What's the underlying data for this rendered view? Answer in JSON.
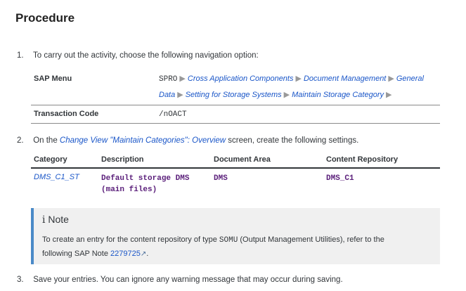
{
  "heading": "Procedure",
  "steps": {
    "s1": {
      "num": "1.",
      "text": "To carry out the activity, choose the following navigation option:"
    },
    "s2": {
      "num": "2.",
      "prefix": "On the ",
      "link": "Change View \"Maintain Categories\": Overview",
      "suffix": " screen, create the following settings."
    },
    "s3": {
      "num": "3.",
      "text": "Save your entries. You can ignore any warning message that may occur during saving."
    }
  },
  "nav_table": {
    "row1_label": "SAP Menu",
    "spro": "SPRO",
    "path": [
      "Cross Application Components",
      "Document Management",
      "General",
      "Data",
      "Setting for Storage Systems",
      "Maintain Storage Category"
    ],
    "row2_label": "Transaction Code",
    "transaction": "/nOACT"
  },
  "settings_table": {
    "headers": [
      "Category",
      "Description",
      "Document Area",
      "Content Repository"
    ],
    "row": {
      "category": "DMS_C1_ST",
      "description_line1": "Default storage DMS",
      "description_line2": "(main files)",
      "area": "DMS",
      "repository": "DMS_C1"
    }
  },
  "note": {
    "icon": "i",
    "title": "Note",
    "text_prefix": "To create an entry for the content repository of type ",
    "code": "SOMU",
    "text_middle": " (Output Management Utilities), refer to the",
    "text_line2": "following SAP Note ",
    "note_number": "2279725",
    "ext_icon": "↗",
    "text_end": "."
  },
  "colors": {
    "link": "#1a56c8",
    "note_bar": "#4a8ac8",
    "code": "#5a1e7a"
  }
}
